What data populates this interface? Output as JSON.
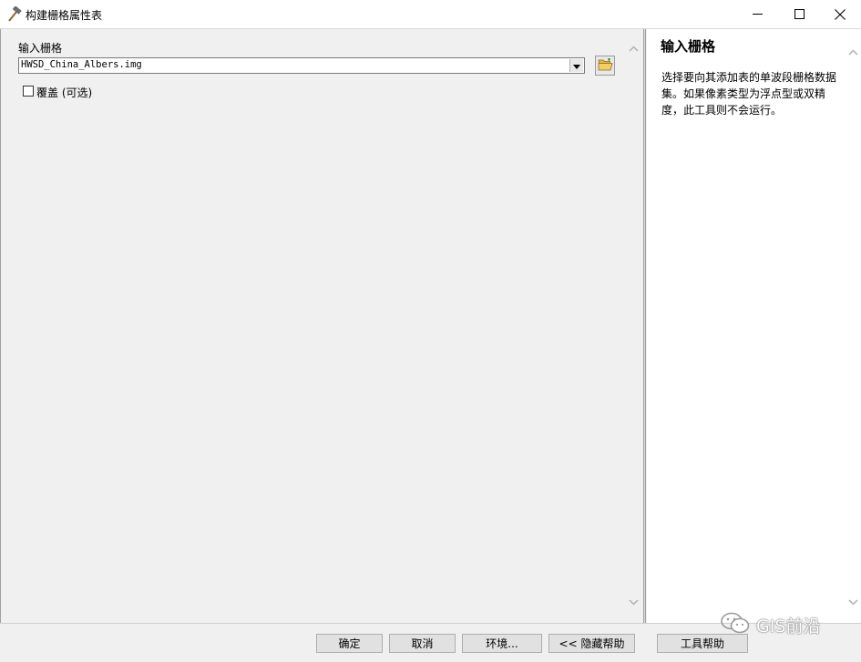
{
  "window": {
    "title": "构建栅格属性表",
    "controls": {
      "minimize": "minimize-icon",
      "maximize": "maximize-icon",
      "close": "close-icon"
    }
  },
  "form": {
    "input_raster_label": "输入栅格",
    "input_raster_value": "HWSD_China_Albers.img",
    "overwrite_label": "覆盖 (可选)",
    "overwrite_checked": false
  },
  "help": {
    "title": "输入栅格",
    "body": "选择要向其添加表的单波段栅格数据集。如果像素类型为浮点型或双精度，此工具则不会运行。"
  },
  "buttons": {
    "ok": "确定",
    "cancel": "取消",
    "environments": "环境...",
    "hide_help": "<< 隐藏帮助",
    "tool_help": "工具帮助"
  },
  "watermark": {
    "text": "GIS前沿"
  },
  "colors": {
    "title_bar": "#ffffff",
    "pane_bg": "#f0f0f0",
    "help_bg": "#ffffff",
    "button_bg": "#e1e1e1"
  }
}
